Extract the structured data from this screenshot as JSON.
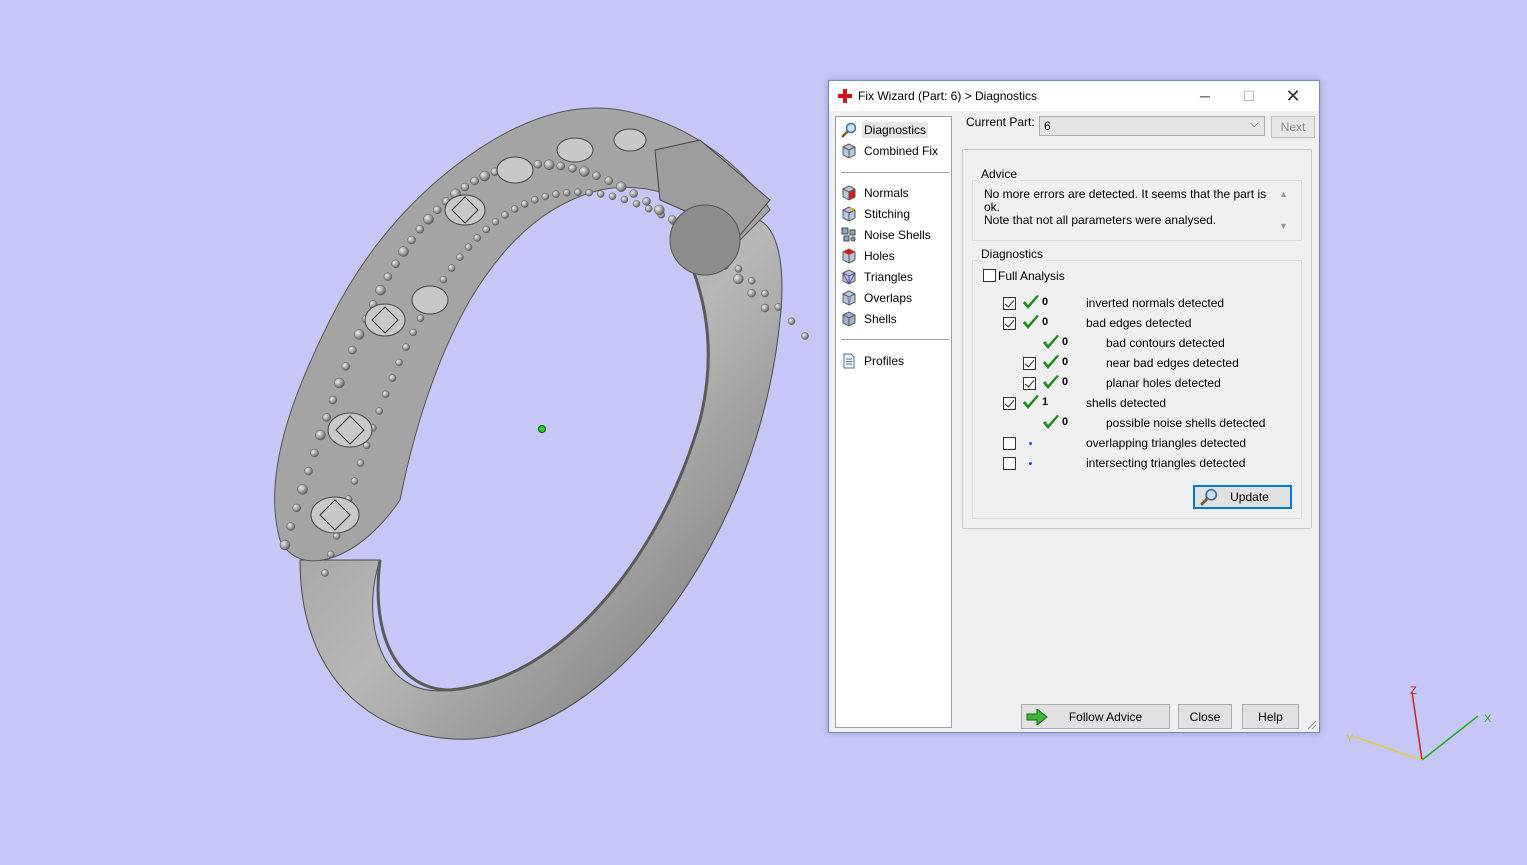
{
  "window": {
    "title": "Fix Wizard (Part: 6) > Diagnostics",
    "minimize": "─",
    "maximize": "☐",
    "close": "✕"
  },
  "nav": {
    "items": [
      {
        "label": "Diagnostics",
        "icon": "magnifier-icon",
        "selected": true
      },
      {
        "label": "Combined Fix",
        "icon": "cube-icon"
      },
      {
        "label": "Normals",
        "icon": "normals-cube-icon"
      },
      {
        "label": "Stitching",
        "icon": "stitching-cube-icon"
      },
      {
        "label": "Noise Shells",
        "icon": "noise-shells-icon"
      },
      {
        "label": "Holes",
        "icon": "holes-cube-icon"
      },
      {
        "label": "Triangles",
        "icon": "triangles-cube-icon"
      },
      {
        "label": "Overlaps",
        "icon": "overlaps-cube-icon"
      },
      {
        "label": "Shells",
        "icon": "shells-cube-icon"
      },
      {
        "label": "Profiles",
        "icon": "document-icon"
      }
    ]
  },
  "current_part": {
    "label": "Current Part:",
    "value": "6",
    "next_label": "Next"
  },
  "advice": {
    "title": "Advice",
    "line1": "No more errors are detected. It seems that the part is ok.",
    "line2": "Note that not all parameters were analysed."
  },
  "diagnostics": {
    "title": "Diagnostics",
    "full_analysis_label": "Full Analysis",
    "full_analysis_checked": false,
    "rows": [
      {
        "checkbox": true,
        "checked": true,
        "status": "ok",
        "count": "0",
        "label": "inverted normals detected",
        "indent": 0
      },
      {
        "checkbox": true,
        "checked": true,
        "status": "ok",
        "count": "0",
        "label": "bad edges detected",
        "indent": 0
      },
      {
        "checkbox": false,
        "status": "ok",
        "count": "0",
        "label": "bad contours detected",
        "indent": 1
      },
      {
        "checkbox": true,
        "checked": true,
        "status": "ok",
        "count": "0",
        "label": "near bad edges detected",
        "indent": 1
      },
      {
        "checkbox": true,
        "checked": true,
        "status": "ok",
        "count": "0",
        "label": "planar holes detected",
        "indent": 1
      },
      {
        "checkbox": true,
        "checked": true,
        "status": "ok",
        "count": "1",
        "label": "shells detected",
        "indent": 0
      },
      {
        "checkbox": false,
        "status": "ok",
        "count": "0",
        "label": "possible noise shells detected",
        "indent": 1
      },
      {
        "checkbox": true,
        "checked": false,
        "status": "pending",
        "count": "",
        "label": "overlapping triangles detected",
        "indent": 0
      },
      {
        "checkbox": true,
        "checked": false,
        "status": "pending",
        "count": "",
        "label": "intersecting triangles detected",
        "indent": 0
      }
    ],
    "update_label": "Update"
  },
  "footer": {
    "follow_advice": "Follow Advice",
    "close": "Close",
    "help": "Help"
  },
  "axes": {
    "x": "X",
    "y": "Y",
    "z": "Z"
  },
  "colors": {
    "viewport_bg": "#c8c8f8",
    "check_green": "#1a8a1a",
    "title_red": "#d11414",
    "focus_blue": "#0078d7"
  }
}
